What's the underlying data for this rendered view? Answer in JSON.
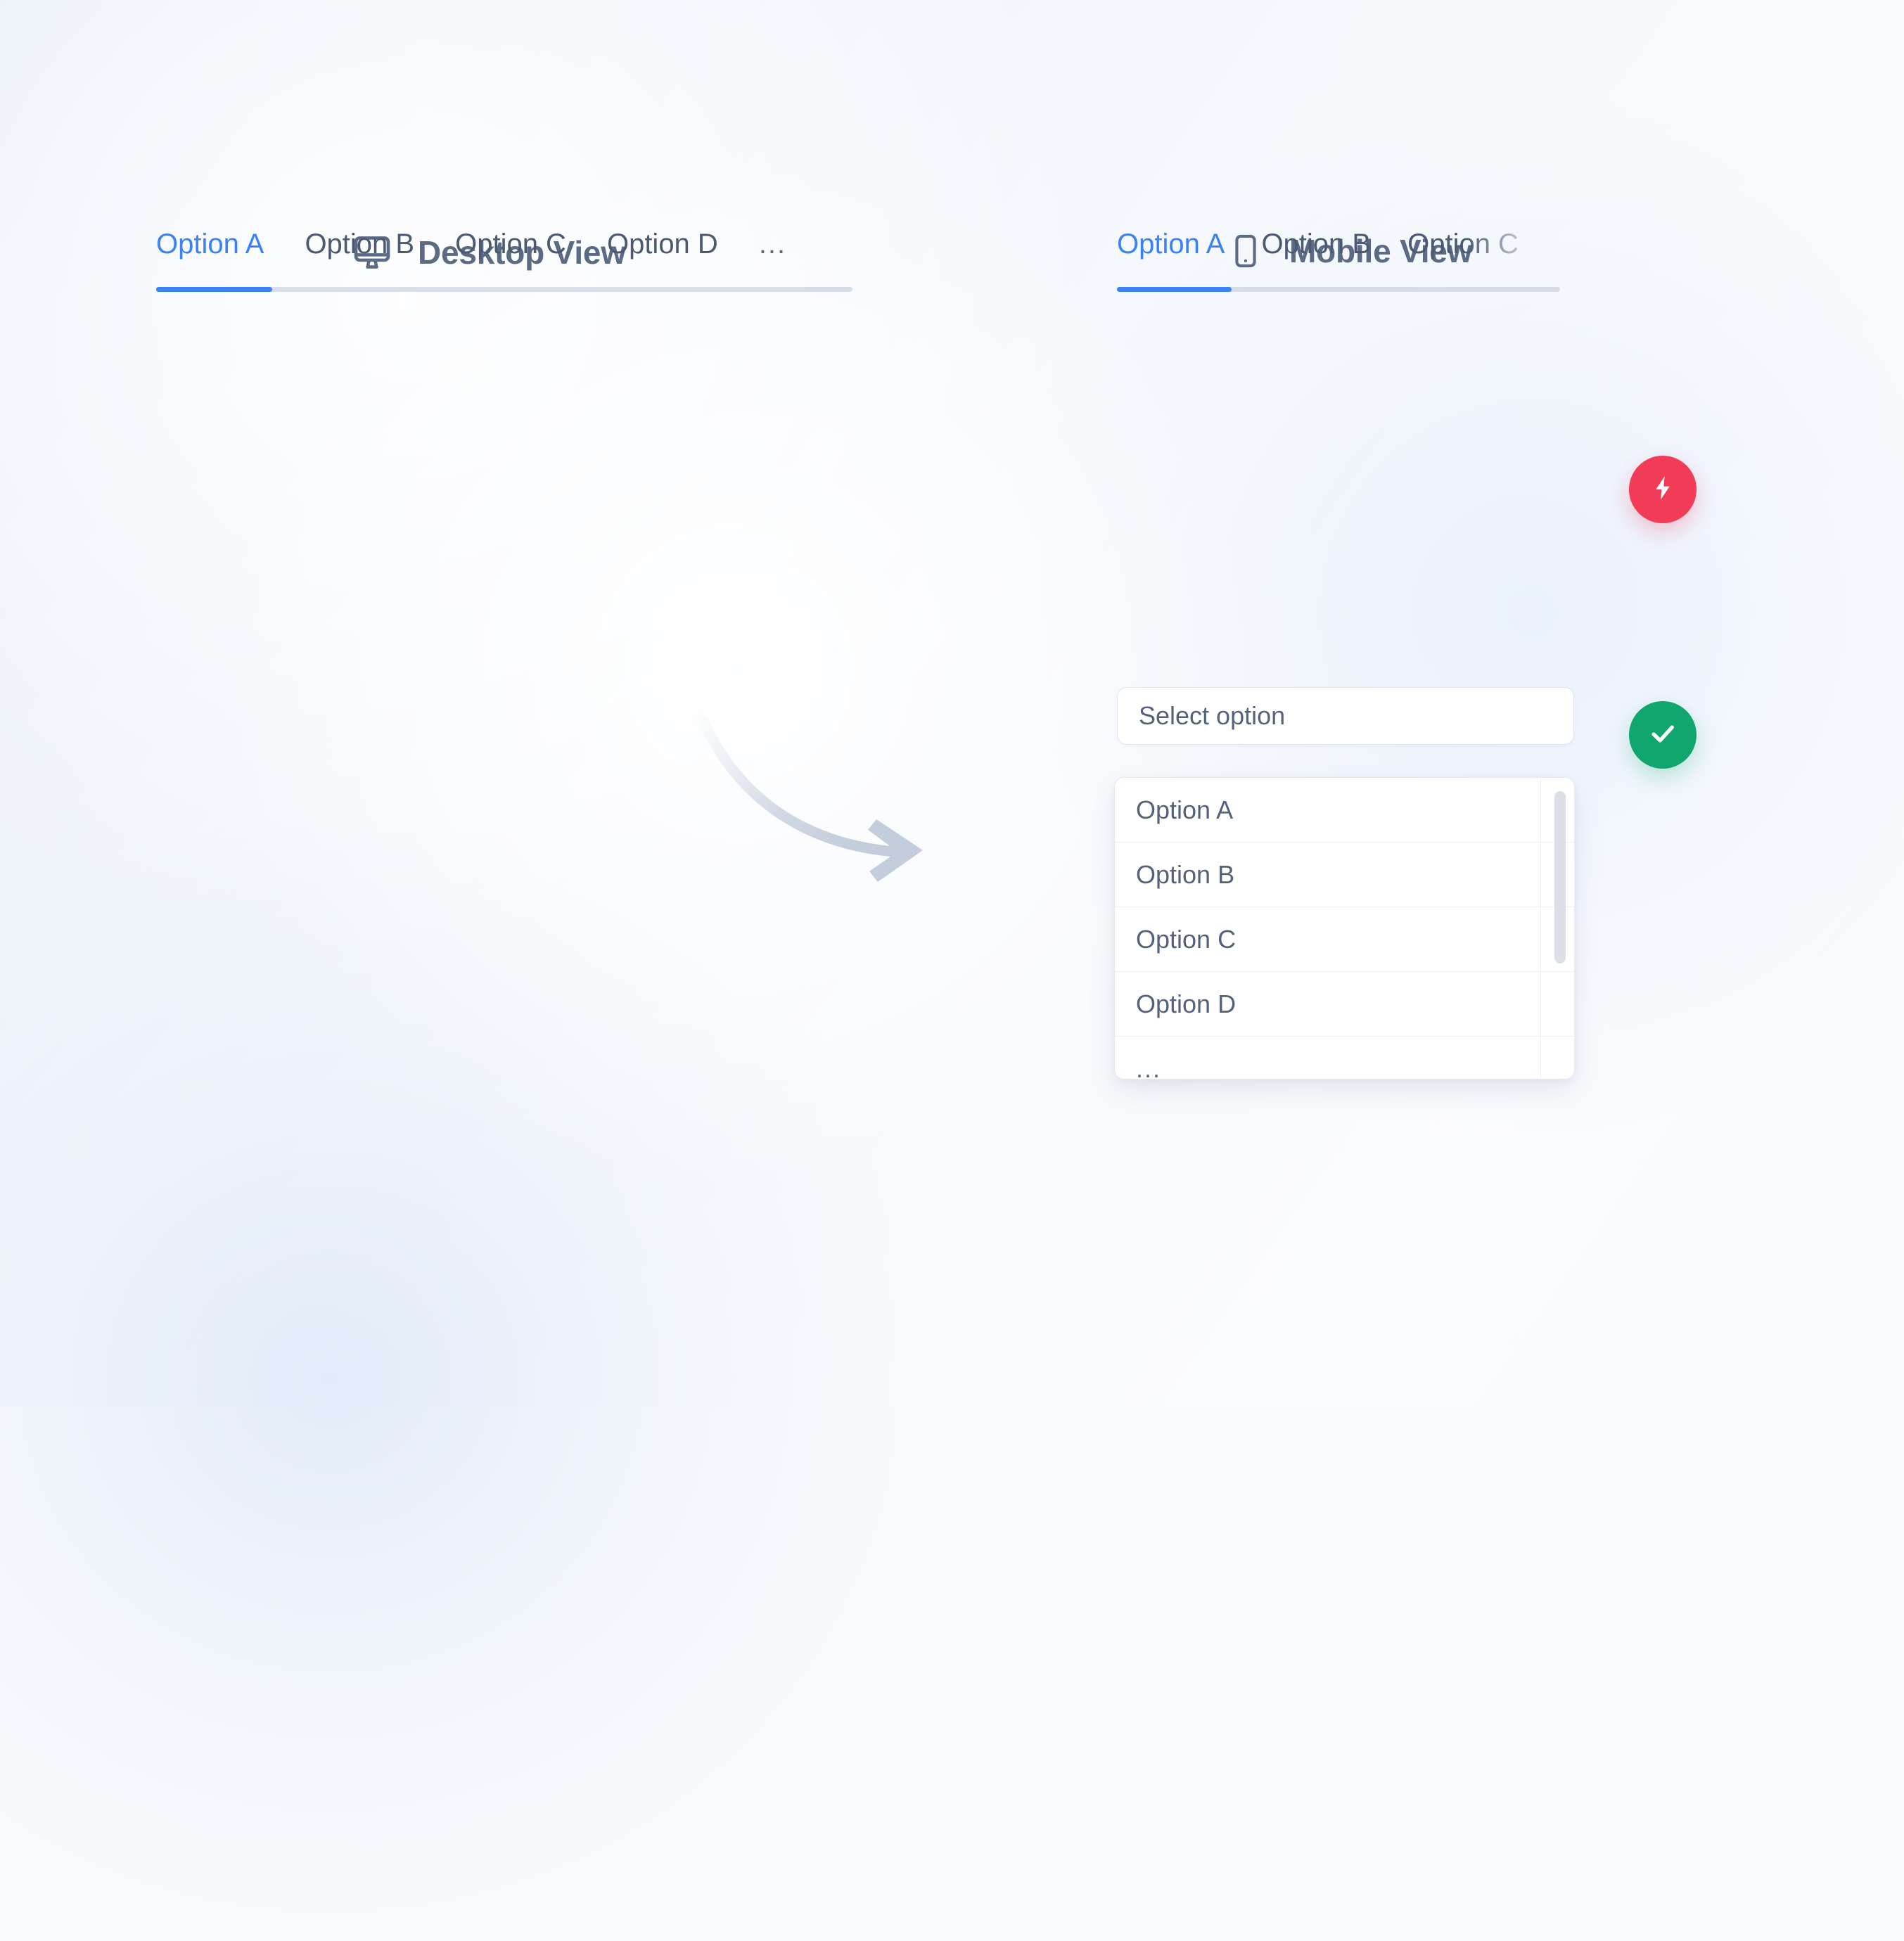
{
  "background": {
    "gradient_from": "#e9eff9",
    "gradient_to": "#fafbfd"
  },
  "theme": {
    "accent_blue": "#3b82f6",
    "text_muted": "#55637a",
    "heading": "#5b6b84",
    "alert_red": "#f23b56",
    "success_green": "#11a66e",
    "track_gray": "#d7dee8"
  },
  "desktop_panel": {
    "title": "Desktop View",
    "icon": "monitor-icon",
    "tabs": [
      {
        "label": "Option A",
        "active": true
      },
      {
        "label": "Option B",
        "active": false
      },
      {
        "label": "Option C",
        "active": false
      },
      {
        "label": "Option D",
        "active": false
      },
      {
        "label": "...",
        "active": false
      }
    ]
  },
  "mobile_panel": {
    "title": "Mobile View",
    "icon": "smartphone-icon",
    "tabs": [
      {
        "label": "Option A",
        "active": true
      },
      {
        "label": "Option B",
        "active": false
      },
      {
        "label": "Option C",
        "active": false
      }
    ],
    "select": {
      "value": "Select option",
      "placeholder": "Select option"
    },
    "dropdown": {
      "items": [
        {
          "label": "Option A"
        },
        {
          "label": "Option B"
        },
        {
          "label": "Option C"
        },
        {
          "label": "Option D"
        },
        {
          "label": "..."
        }
      ]
    }
  },
  "badges": [
    {
      "name": "alert-badge",
      "icon": "lightning-bolt-icon",
      "color": "#f23b56"
    },
    {
      "name": "success-badge",
      "icon": "check-icon",
      "color": "#11a66e"
    }
  ],
  "arrow": {
    "name": "flow-arrow-icon",
    "color": "#cfd7e2"
  }
}
